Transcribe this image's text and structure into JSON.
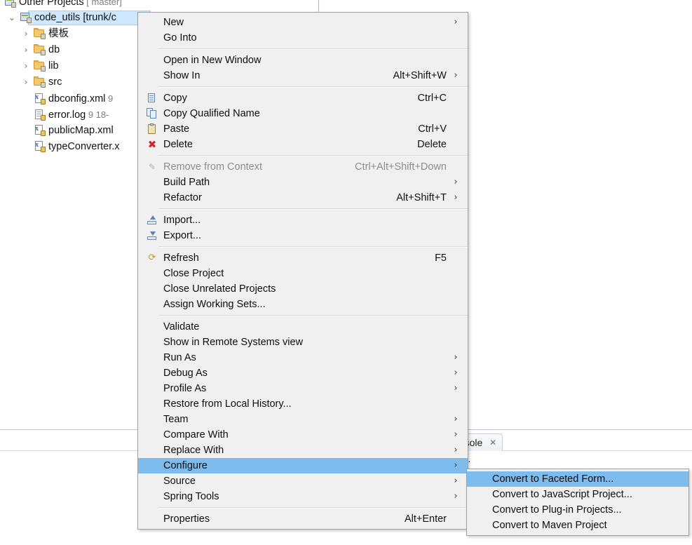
{
  "explorer": {
    "rows": [
      {
        "indent": 6,
        "twisty": "",
        "icon": "project-icon",
        "label": "Other Projects",
        "meta": "[ master]",
        "selected": false,
        "clipped": true
      },
      {
        "indent": 28,
        "twisty": "⌄",
        "icon": "project-icon",
        "label": "code_utils [trunk/c",
        "meta": "",
        "selected": true,
        "clipped": false
      },
      {
        "indent": 48,
        "twisty": "›",
        "icon": "folder-icon",
        "label": "模板",
        "meta": "",
        "selected": false,
        "clipped": false
      },
      {
        "indent": 48,
        "twisty": "›",
        "icon": "folder-icon",
        "label": "db",
        "meta": "",
        "selected": false,
        "clipped": false
      },
      {
        "indent": 48,
        "twisty": "›",
        "icon": "folder-icon",
        "label": "lib",
        "meta": "",
        "selected": false,
        "clipped": false
      },
      {
        "indent": 48,
        "twisty": "›",
        "icon": "folder-icon",
        "label": "src",
        "meta": "",
        "selected": false,
        "clipped": false
      },
      {
        "indent": 48,
        "twisty": "",
        "icon": "xml-file-icon",
        "label": "dbconfig.xml",
        "meta": "9",
        "selected": false,
        "clipped": false
      },
      {
        "indent": 48,
        "twisty": "",
        "icon": "log-file-icon",
        "label": "error.log",
        "meta": "9   18-",
        "selected": false,
        "clipped": false
      },
      {
        "indent": 48,
        "twisty": "",
        "icon": "xml-file-icon",
        "label": "publicMap.xml",
        "meta": "",
        "selected": false,
        "clipped": false
      },
      {
        "indent": 48,
        "twisty": "",
        "icon": "xml-file-icon",
        "label": "typeConverter.x",
        "meta": "",
        "selected": false,
        "clipped": false
      }
    ]
  },
  "console_view": {
    "tab_label": "onsole",
    "close_glyph": "✕",
    "body_text": "time."
  },
  "context_menu": {
    "items": [
      {
        "type": "item",
        "label": "New",
        "accel": "",
        "arrow": true,
        "icon": "",
        "disabled": false,
        "highlighted": false
      },
      {
        "type": "item",
        "label": "Go Into",
        "accel": "",
        "arrow": false,
        "icon": "",
        "disabled": false,
        "highlighted": false
      },
      {
        "type": "sep"
      },
      {
        "type": "item",
        "label": "Open in New Window",
        "accel": "",
        "arrow": false,
        "icon": "",
        "disabled": false,
        "highlighted": false
      },
      {
        "type": "item",
        "label": "Show In",
        "accel": "Alt+Shift+W",
        "arrow": true,
        "icon": "",
        "disabled": false,
        "highlighted": false
      },
      {
        "type": "sep"
      },
      {
        "type": "item",
        "label": "Copy",
        "accel": "Ctrl+C",
        "arrow": false,
        "icon": "copy-icon",
        "disabled": false,
        "highlighted": false
      },
      {
        "type": "item",
        "label": "Copy Qualified Name",
        "accel": "",
        "arrow": false,
        "icon": "copy-qualified-icon",
        "disabled": false,
        "highlighted": false
      },
      {
        "type": "item",
        "label": "Paste",
        "accel": "Ctrl+V",
        "arrow": false,
        "icon": "paste-icon",
        "disabled": false,
        "highlighted": false
      },
      {
        "type": "item",
        "label": "Delete",
        "accel": "Delete",
        "arrow": false,
        "icon": "delete-icon",
        "disabled": false,
        "highlighted": false
      },
      {
        "type": "sep"
      },
      {
        "type": "item",
        "label": "Remove from Context",
        "accel": "Ctrl+Alt+Shift+Down",
        "arrow": false,
        "icon": "remove-from-context-icon",
        "disabled": true,
        "highlighted": false
      },
      {
        "type": "item",
        "label": "Build Path",
        "accel": "",
        "arrow": true,
        "icon": "",
        "disabled": false,
        "highlighted": false
      },
      {
        "type": "item",
        "label": "Refactor",
        "accel": "Alt+Shift+T",
        "arrow": true,
        "icon": "",
        "disabled": false,
        "highlighted": false
      },
      {
        "type": "sep"
      },
      {
        "type": "item",
        "label": "Import...",
        "accel": "",
        "arrow": false,
        "icon": "import-icon",
        "disabled": false,
        "highlighted": false
      },
      {
        "type": "item",
        "label": "Export...",
        "accel": "",
        "arrow": false,
        "icon": "export-icon",
        "disabled": false,
        "highlighted": false
      },
      {
        "type": "sep"
      },
      {
        "type": "item",
        "label": "Refresh",
        "accel": "F5",
        "arrow": false,
        "icon": "refresh-icon",
        "disabled": false,
        "highlighted": false
      },
      {
        "type": "item",
        "label": "Close Project",
        "accel": "",
        "arrow": false,
        "icon": "",
        "disabled": false,
        "highlighted": false
      },
      {
        "type": "item",
        "label": "Close Unrelated Projects",
        "accel": "",
        "arrow": false,
        "icon": "",
        "disabled": false,
        "highlighted": false
      },
      {
        "type": "item",
        "label": "Assign Working Sets...",
        "accel": "",
        "arrow": false,
        "icon": "",
        "disabled": false,
        "highlighted": false
      },
      {
        "type": "sep"
      },
      {
        "type": "item",
        "label": "Validate",
        "accel": "",
        "arrow": false,
        "icon": "",
        "disabled": false,
        "highlighted": false
      },
      {
        "type": "item",
        "label": "Show in Remote Systems view",
        "accel": "",
        "arrow": false,
        "icon": "",
        "disabled": false,
        "highlighted": false
      },
      {
        "type": "item",
        "label": "Run As",
        "accel": "",
        "arrow": true,
        "icon": "",
        "disabled": false,
        "highlighted": false
      },
      {
        "type": "item",
        "label": "Debug As",
        "accel": "",
        "arrow": true,
        "icon": "",
        "disabled": false,
        "highlighted": false
      },
      {
        "type": "item",
        "label": "Profile As",
        "accel": "",
        "arrow": true,
        "icon": "",
        "disabled": false,
        "highlighted": false
      },
      {
        "type": "item",
        "label": "Restore from Local History...",
        "accel": "",
        "arrow": false,
        "icon": "",
        "disabled": false,
        "highlighted": false
      },
      {
        "type": "item",
        "label": "Team",
        "accel": "",
        "arrow": true,
        "icon": "",
        "disabled": false,
        "highlighted": false
      },
      {
        "type": "item",
        "label": "Compare With",
        "accel": "",
        "arrow": true,
        "icon": "",
        "disabled": false,
        "highlighted": false
      },
      {
        "type": "item",
        "label": "Replace With",
        "accel": "",
        "arrow": true,
        "icon": "",
        "disabled": false,
        "highlighted": false
      },
      {
        "type": "item",
        "label": "Configure",
        "accel": "",
        "arrow": true,
        "icon": "",
        "disabled": false,
        "highlighted": true
      },
      {
        "type": "item",
        "label": "Source",
        "accel": "",
        "arrow": true,
        "icon": "",
        "disabled": false,
        "highlighted": false
      },
      {
        "type": "item",
        "label": "Spring Tools",
        "accel": "",
        "arrow": true,
        "icon": "",
        "disabled": false,
        "highlighted": false
      },
      {
        "type": "sep"
      },
      {
        "type": "item",
        "label": "Properties",
        "accel": "Alt+Enter",
        "arrow": false,
        "icon": "",
        "disabled": false,
        "highlighted": false
      }
    ]
  },
  "sub_menu": {
    "parent": "Configure",
    "items": [
      {
        "type": "item",
        "label": "Convert to Faceted Form...",
        "accel": "",
        "arrow": false,
        "icon": "",
        "disabled": false,
        "highlighted": true
      },
      {
        "type": "item",
        "label": "Convert to JavaScript Project...",
        "accel": "",
        "arrow": false,
        "icon": "",
        "disabled": false,
        "highlighted": false
      },
      {
        "type": "item",
        "label": "Convert to Plug-in Projects...",
        "accel": "",
        "arrow": false,
        "icon": "",
        "disabled": false,
        "highlighted": false
      },
      {
        "type": "item",
        "label": "Convert to Maven Project",
        "accel": "",
        "arrow": false,
        "icon": "",
        "disabled": false,
        "highlighted": false
      }
    ]
  },
  "colors": {
    "menu_bg": "#f0f0f0",
    "menu_border": "#a0a0a0",
    "highlight": "#7fbcee",
    "tree_selection": "#cde8ff",
    "disabled_text": "#8d8d8d"
  }
}
